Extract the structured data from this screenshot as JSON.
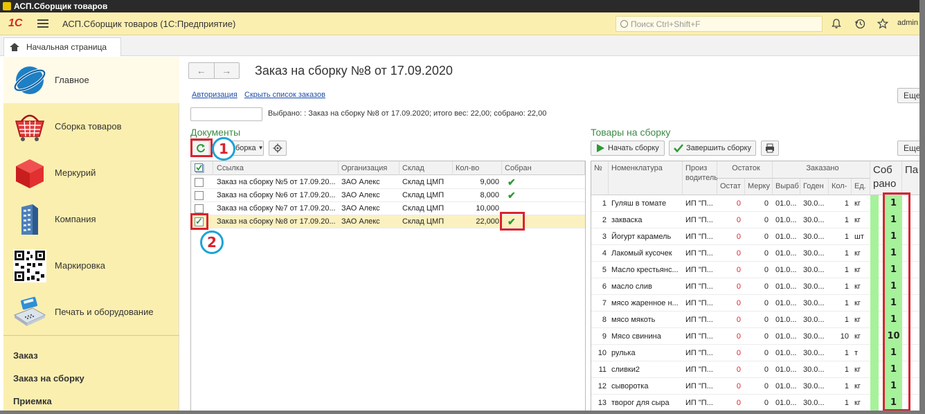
{
  "window": {
    "title": "АСП.Сборщик товаров"
  },
  "topbar": {
    "logo": "1С",
    "app_title": "АСП.Сборщик товаров  (1С:Предприятие)",
    "search_placeholder": "Поиск Ctrl+Shift+F",
    "user": "admin",
    "icons": [
      "bell-icon",
      "history-icon",
      "star-icon"
    ]
  },
  "tabs": {
    "home": "Начальная страница"
  },
  "sidebar": {
    "items": [
      {
        "label": "Главное",
        "icon": "globe-icon"
      },
      {
        "label": "Сборка товаров",
        "icon": "basket-icon"
      },
      {
        "label": "Меркурий",
        "icon": "cube-icon"
      },
      {
        "label": "Компания",
        "icon": "building-icon"
      },
      {
        "label": "Маркировка",
        "icon": "qr-code-icon"
      },
      {
        "label": "Печать и оборудование",
        "icon": "card-terminal-icon"
      }
    ],
    "links": [
      "Заказ",
      "Заказ на сборку",
      "Приемка"
    ]
  },
  "main": {
    "title": "Заказ на сборку №8 от 17.09.2020",
    "links": {
      "auth": "Авторизация",
      "hide_orders": "Скрыть список заказов"
    },
    "more_label": "Еще",
    "selected_text": "Выбрано:  : Заказ на сборку №8 от 17.09.2020; итого вес: 22,00; собрано: 22,00",
    "documents": {
      "title": "Документы",
      "assembly_button": "Сборка",
      "headers": [
        "Ссылка",
        "Организация",
        "Склад",
        "Кол-во",
        "Собран"
      ],
      "rows": [
        {
          "ref": "Заказ на сборку №5 от 17.09.20...",
          "org": "ЗАО Алекс",
          "warehouse": "Склад ЦМП",
          "qty": "9,000",
          "done": true,
          "checked": false
        },
        {
          "ref": "Заказ на сборку №6 от 17.09.20...",
          "org": "ЗАО Алекс",
          "warehouse": "Склад ЦМП",
          "qty": "8,000",
          "done": true,
          "checked": false
        },
        {
          "ref": "Заказ на сборку №7 от 17.09.20...",
          "org": "ЗАО Алекс",
          "warehouse": "Склад ЦМП",
          "qty": "10,000",
          "done": false,
          "checked": false
        },
        {
          "ref": "Заказ на сборку №8 от 17.09.20...",
          "org": "ЗАО Алекс",
          "warehouse": "Склад ЦМП",
          "qty": "22,000",
          "done": true,
          "checked": true
        }
      ]
    },
    "goods": {
      "title": "Товары на сборку",
      "start_button": "Начать сборку",
      "finish_button": "Завершить сборку",
      "more_label": "Еще",
      "headers": {
        "num": "№",
        "name": "Номенклатура",
        "producer": "Произ водитель",
        "stock": "Остаток",
        "stock_rest": "Остат",
        "stock_measure": "Мерку",
        "ordered": "Заказано",
        "ordered_date": "Выраб",
        "ordered_valid": "Годен",
        "ordered_qty": "Кол-",
        "ordered_unit": "Ед.",
        "collected": "Соб рано",
        "pa": "Па"
      },
      "rows": [
        {
          "n": "1",
          "name": "Гуляш в томате",
          "producer": "ИП \"П...",
          "rest": "0",
          "merc": "0",
          "date": "01.0...",
          "valid": "30.0...",
          "qty": "1",
          "unit": "кг",
          "collected": "1"
        },
        {
          "n": "2",
          "name": "закваска",
          "producer": "ИП \"П...",
          "rest": "0",
          "merc": "0",
          "date": "01.0...",
          "valid": "30.0...",
          "qty": "1",
          "unit": "кг",
          "collected": "1"
        },
        {
          "n": "3",
          "name": "Йогурт карамель",
          "producer": "ИП \"П...",
          "rest": "0",
          "merc": "0",
          "date": "01.0...",
          "valid": "30.0...",
          "qty": "1",
          "unit": "шт",
          "collected": "1"
        },
        {
          "n": "4",
          "name": "Лакомый кусочек",
          "producer": "ИП \"П...",
          "rest": "0",
          "merc": "0",
          "date": "01.0...",
          "valid": "30.0...",
          "qty": "1",
          "unit": "кг",
          "collected": "1"
        },
        {
          "n": "5",
          "name": "Масло крестьянс...",
          "producer": "ИП \"П...",
          "rest": "0",
          "merc": "0",
          "date": "01.0...",
          "valid": "30.0...",
          "qty": "1",
          "unit": "кг",
          "collected": "1"
        },
        {
          "n": "6",
          "name": "масло слив",
          "producer": "ИП \"П...",
          "rest": "0",
          "merc": "0",
          "date": "01.0...",
          "valid": "30.0...",
          "qty": "1",
          "unit": "кг",
          "collected": "1"
        },
        {
          "n": "7",
          "name": "мясо жаренное н...",
          "producer": "ИП \"П...",
          "rest": "0",
          "merc": "0",
          "date": "01.0...",
          "valid": "30.0...",
          "qty": "1",
          "unit": "кг",
          "collected": "1"
        },
        {
          "n": "8",
          "name": "мясо мякоть",
          "producer": "ИП \"П...",
          "rest": "0",
          "merc": "0",
          "date": "01.0...",
          "valid": "30.0...",
          "qty": "1",
          "unit": "кг",
          "collected": "1"
        },
        {
          "n": "9",
          "name": "Мясо свинина",
          "producer": "ИП \"П...",
          "rest": "0",
          "merc": "0",
          "date": "01.0...",
          "valid": "30.0...",
          "qty": "10",
          "unit": "кг",
          "collected": "10"
        },
        {
          "n": "10",
          "name": "рулька",
          "producer": "ИП \"П...",
          "rest": "0",
          "merc": "0",
          "date": "01.0...",
          "valid": "30.0...",
          "qty": "1",
          "unit": "т",
          "collected": "1"
        },
        {
          "n": "11",
          "name": "сливки2",
          "producer": "ИП \"П...",
          "rest": "0",
          "merc": "0",
          "date": "01.0...",
          "valid": "30.0...",
          "qty": "1",
          "unit": "кг",
          "collected": "1"
        },
        {
          "n": "12",
          "name": "сыворотка",
          "producer": "ИП \"П...",
          "rest": "0",
          "merc": "0",
          "date": "01.0...",
          "valid": "30.0...",
          "qty": "1",
          "unit": "кг",
          "collected": "1"
        },
        {
          "n": "13",
          "name": "творог для сыра",
          "producer": "ИП \"П...",
          "rest": "0",
          "merc": "0",
          "date": "01.0...",
          "valid": "30.0...",
          "qty": "1",
          "unit": "кг",
          "collected": "1"
        }
      ]
    },
    "markers": [
      "1",
      "2"
    ]
  },
  "colors": {
    "accent_yellow": "#fbefb0",
    "highlight_red": "#d9232e",
    "marker_blue": "#1ba3d8",
    "collected_green": "#a6f29a",
    "section_green": "#3c8a47"
  }
}
